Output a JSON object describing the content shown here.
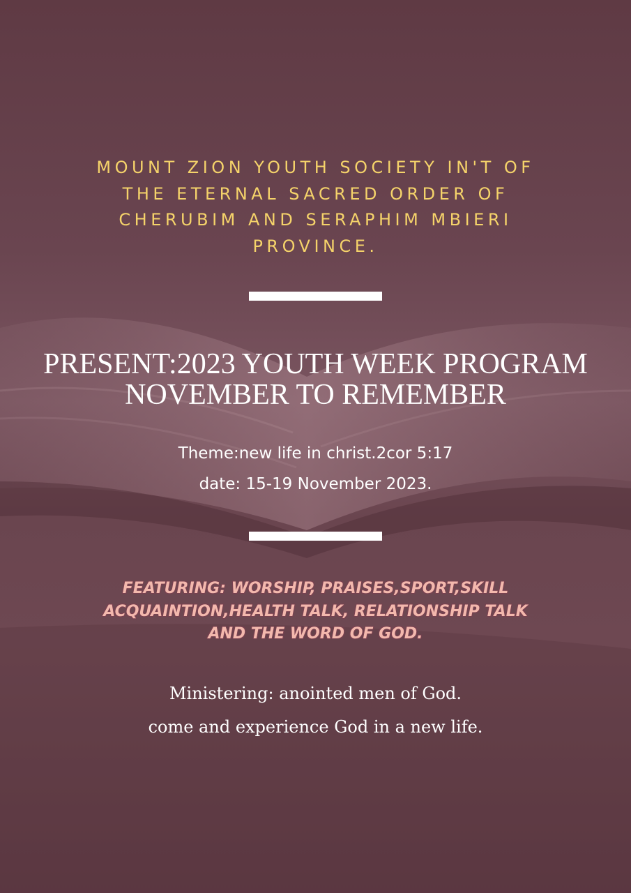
{
  "colors": {
    "background": "#5f3a44",
    "heading_gold": "#f5d36a",
    "featuring_pink": "#f3b8ad",
    "text_white": "#ffffff"
  },
  "background_image": "open-bible-book",
  "organization": {
    "lines": [
      "MOUNT ZION YOUTH SOCIETY IN'T OF",
      "THE ETERNAL SACRED ORDER OF",
      "CHERUBIM AND SERAPHIM MBIERI",
      "PROVINCE."
    ]
  },
  "title": {
    "lines": [
      "PRESENT:2023 YOUTH WEEK PROGRAM",
      "NOVEMBER TO REMEMBER"
    ]
  },
  "details": {
    "theme": "Theme:new life in christ.2cor 5:17",
    "date": "date: 15-19 November 2023."
  },
  "featuring": {
    "lines": [
      "FEATURING: WORSHIP, PRAISES,SPORT,SKILL",
      "ACQUAINTION,HEALTH TALK, RELATIONSHIP TALK",
      "AND THE WORD OF GOD."
    ]
  },
  "ministering": {
    "line1": "Ministering: anointed men of God.",
    "line2": "come and experience God in a new life."
  }
}
